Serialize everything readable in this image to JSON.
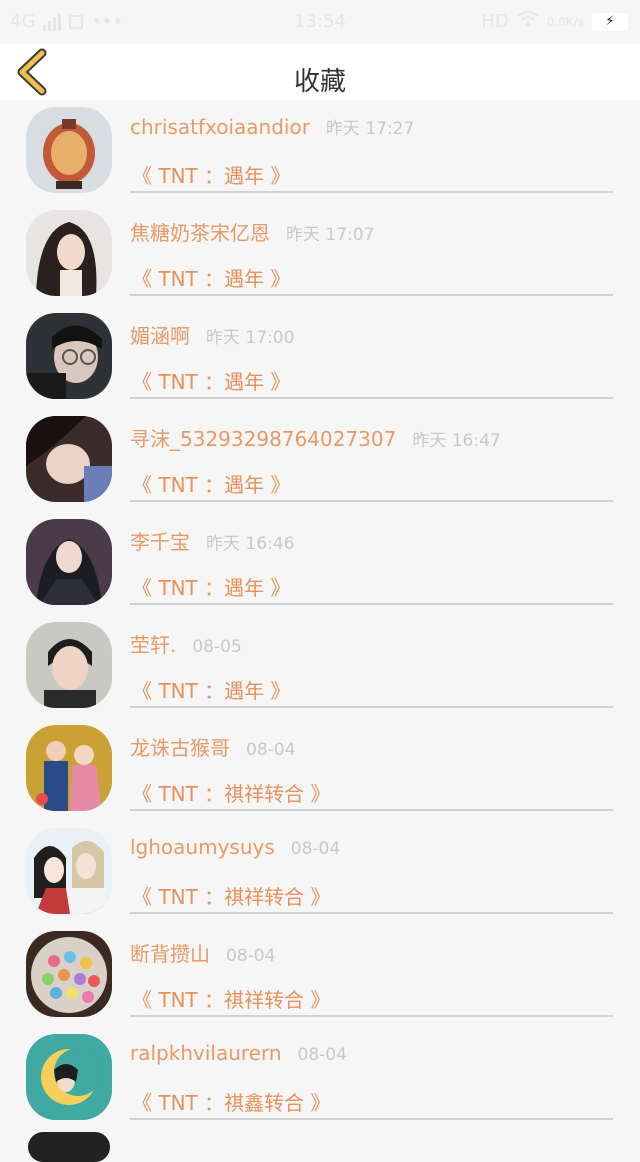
{
  "status_bar": {
    "network": "4G",
    "time": "13:54",
    "hd": "HD",
    "speed": "0.0K/s",
    "battery_charging": true
  },
  "header": {
    "title": "收藏",
    "back_icon": "chevron-left-icon"
  },
  "colors": {
    "name": "#e89a66",
    "work": "#e8915a",
    "time": "#c8c8c8",
    "divider": "#d2d2d2",
    "back": "#e8c24a"
  },
  "items": [
    {
      "name": "chrisatfxoiaandior",
      "time": "昨天 17:27",
      "work": "《 TNT ：遇年 》",
      "avatar": "vase-avatar"
    },
    {
      "name": "焦糖奶茶宋亿恩",
      "time": "昨天 17:07",
      "work": "《 TNT ：遇年 》",
      "avatar": "girl-avatar"
    },
    {
      "name": "媚涵啊",
      "time": "昨天 17:00",
      "work": "《 TNT ：遇年 》",
      "avatar": "glasses-avatar"
    },
    {
      "name": "寻沫_53293298764027307",
      "time": "昨天 16:47",
      "work": "《 TNT ：遇年 》",
      "avatar": "sleeping-avatar"
    },
    {
      "name": "李千宝",
      "time": "昨天 16:46",
      "work": "《 TNT ：遇年 》",
      "avatar": "costume-avatar"
    },
    {
      "name": "茔轩.",
      "time": "08-05",
      "work": "《 TNT ：遇年 》",
      "avatar": "boy-avatar"
    },
    {
      "name": "龙诛古猴哥",
      "time": "08-04",
      "work": "《 TNT ：祺祥转合 》",
      "avatar": "couple-avatar"
    },
    {
      "name": "lghoaumysuys",
      "time": "08-04",
      "work": "《 TNT ：祺祥转合 》",
      "avatar": "anime-avatar"
    },
    {
      "name": "断背攒山",
      "time": "08-04",
      "work": "《 TNT ：祺祥转合 》",
      "avatar": "candy-avatar"
    },
    {
      "name": "ralpkhvilaurern",
      "time": "08-04",
      "work": "《 TNT ：祺鑫转合 》",
      "avatar": "moon-avatar"
    }
  ]
}
